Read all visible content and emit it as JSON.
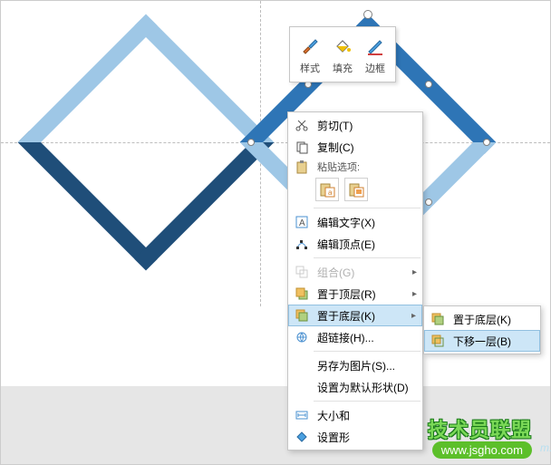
{
  "mini_toolbar": {
    "style": "样式",
    "fill": "填充",
    "outline": "边框"
  },
  "context_menu": {
    "cut": "剪切(T)",
    "copy": "复制(C)",
    "paste_label": "粘贴选项:",
    "edit_text": "编辑文字(X)",
    "edit_points": "编辑顶点(E)",
    "group": "组合(G)",
    "bring_front": "置于顶层(R)",
    "send_back": "置于底层(K)",
    "hyperlink": "超链接(H)...",
    "save_as_pic": "另存为图片(S)...",
    "set_default_shape": "设置为默认形状(D)",
    "size_and": "大小和",
    "format_shape": "设置形"
  },
  "submenu": {
    "send_to_back": "置于底层(K)",
    "send_backward": "下移一层(B)"
  },
  "watermark": {
    "title": "技术员联盟",
    "url": "www.jsgho.com",
    "suffix": "m.cn"
  }
}
